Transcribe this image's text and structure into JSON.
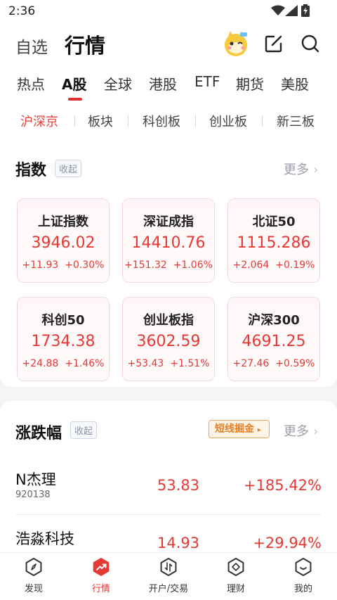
{
  "status_bar": {
    "time": "2:36"
  },
  "header": {
    "tab_favorites": "自选",
    "tab_market": "行情"
  },
  "markets": [
    "热点",
    "A股",
    "全球",
    "港股",
    "ETF",
    "期货",
    "美股"
  ],
  "subtabs": [
    "沪深京",
    "板块",
    "科创板",
    "创业板",
    "新三板"
  ],
  "index_section": {
    "title": "指数",
    "collapse": "收起",
    "more": "更多",
    "tiles": [
      {
        "name": "上证指数",
        "value": "3946.02",
        "change": "+11.93",
        "pct": "+0.30%"
      },
      {
        "name": "深证成指",
        "value": "14410.76",
        "change": "+151.32",
        "pct": "+1.06%"
      },
      {
        "name": "北证50",
        "value": "1115.286",
        "change": "+2.064",
        "pct": "+0.19%"
      },
      {
        "name": "科创50",
        "value": "1734.38",
        "change": "+24.88",
        "pct": "+1.46%"
      },
      {
        "name": "创业板指",
        "value": "3602.59",
        "change": "+53.43",
        "pct": "+1.51%"
      },
      {
        "name": "沪深300",
        "value": "4691.25",
        "change": "+27.46",
        "pct": "+0.59%"
      }
    ]
  },
  "movers_section": {
    "title": "涨跌幅",
    "collapse": "收起",
    "promo": "短线掘金",
    "more": "更多",
    "rows": [
      {
        "name": "N杰理",
        "code": "920138",
        "price": "53.83",
        "pct": "+185.42%"
      },
      {
        "name": "浩淼科技",
        "code": "",
        "price": "14.93",
        "pct": "+29.94%"
      }
    ]
  },
  "bottom_nav": [
    "发现",
    "行情",
    "开户/交易",
    "理财",
    "我的"
  ],
  "colors": {
    "accent": "#e53935",
    "promo": "#e67e22"
  }
}
